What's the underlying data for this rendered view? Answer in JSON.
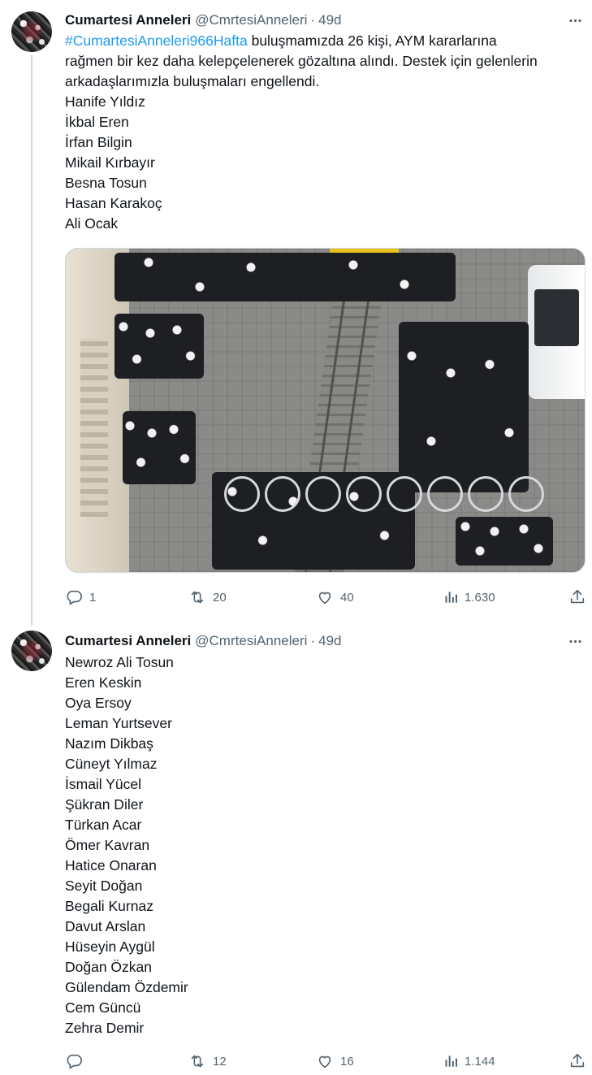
{
  "tweets": [
    {
      "author": "Cumartesi Anneleri",
      "handle": "@CmrtesiAnneleri",
      "separator": "·",
      "time": "49d",
      "hashtag": "#CumartesiAnneleri966Hafta",
      "lines": [
        " buluşmamızda 26 kişi,  AYM kararlarına",
        "rağmen bir kez daha kelepçelenerek gözaltına alındı. Destek için gelenlerin",
        "arkadaşlarımızla buluşmaları engellendi.",
        "Hanife Yıldız",
        "İkbal Eren",
        "İrfan Bilgin",
        "Mikail Kırbayır",
        "Besna Tosun",
        "Hasan Karakoç",
        "Ali Ocak"
      ],
      "stats": {
        "replies": "1",
        "retweets": "20",
        "likes": "40",
        "views": "1.630"
      }
    },
    {
      "author": "Cumartesi Anneleri",
      "handle": "@CmrtesiAnneleri",
      "separator": "·",
      "time": "49d",
      "lines": [
        "Newroz Ali Tosun",
        "Eren Keskin",
        "Oya Ersoy",
        "Leman Yurtsever",
        "Nazım Dikbaş",
        "Cüneyt Yılmaz",
        "İsmail Yücel",
        "Şükran Diler",
        "Türkan Acar",
        "Ömer Kavran",
        "Hatice Onaran",
        "Seyit Doğan",
        "Begali Kurnaz",
        "Davut Arslan",
        "Hüseyin Aygül",
        "Doğan Özkan",
        "Gülendam Özdemir",
        "Cem Güncü",
        "Zehra Demir"
      ],
      "stats": {
        "replies": "",
        "retweets": "12",
        "likes": "16",
        "views": "1.144"
      }
    }
  ],
  "icons": {
    "more": "more-horizontal-icon",
    "reply": "reply-icon",
    "retweet": "retweet-icon",
    "like": "heart-icon",
    "views": "views-chart-icon",
    "share": "share-icon"
  },
  "colors": {
    "link": "#1d9bf0",
    "secondary": "#536471",
    "text": "#0f1419",
    "divider": "#cfd9de"
  }
}
